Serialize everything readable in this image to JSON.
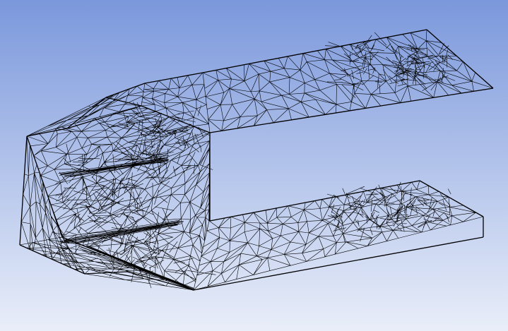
{
  "viewport": {
    "background_top_color": "#7b98dc",
    "background_bottom_color": "#e9eef9",
    "mesh_color": "#000000",
    "view_mode": "wireframe",
    "icon": "tetrahedral-mesh-wireframe"
  }
}
